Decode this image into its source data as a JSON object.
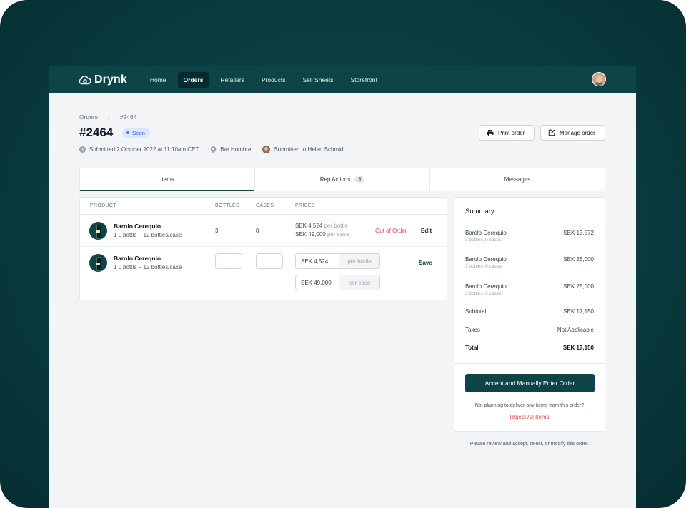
{
  "nav": {
    "logo": "Drynk",
    "items": [
      {
        "label": "Home",
        "active": false
      },
      {
        "label": "Orders",
        "active": true
      },
      {
        "label": "Retailers",
        "active": false
      },
      {
        "label": "Products",
        "active": false
      },
      {
        "label": "Sell Sheets",
        "active": false
      },
      {
        "label": "Storefront",
        "active": false
      }
    ]
  },
  "breadcrumb": {
    "parent": "Orders",
    "current": "#2464"
  },
  "order": {
    "title": "#2464",
    "status": "Seen",
    "submitted": "Submitted 2 October 2022 at 11:10am CET",
    "location": "Bar Hombre",
    "submitted_to": "Submitted to Helen Schmidt"
  },
  "actions": {
    "print": "Print order",
    "manage": "Manage order"
  },
  "tabs": [
    {
      "label": "Items",
      "active": true,
      "count": ""
    },
    {
      "label": "Rep Actions",
      "active": false,
      "count": "3"
    },
    {
      "label": "Messages",
      "active": false,
      "count": ""
    }
  ],
  "table": {
    "headers": {
      "product": "PRODUCT",
      "bottles": "BOTTLES",
      "cases": "CASES",
      "prices": "PRICES"
    },
    "rows": [
      {
        "name": "Barolo Cerequio",
        "detail": "1 L bottle – 12 bottles/case",
        "bottles": "3",
        "cases": "0",
        "price_bottle": "SEK 4,524",
        "price_bottle_unit": "per bottle",
        "price_case": "SEK 49,000",
        "price_case_unit": "per case",
        "status": "Out of Order",
        "action": "Edit"
      },
      {
        "name": "Barolo Cerequio",
        "detail": "1 L bottle – 12 bottles/case",
        "bottles": "",
        "cases": "",
        "price_bottle": "SEK 4,524",
        "price_bottle_unit": "per bottle",
        "price_case": "SEK 49,000",
        "price_case_unit": "per case",
        "action": "Save"
      }
    ]
  },
  "summary": {
    "title": "Summary",
    "lines": [
      {
        "label": "Barolo Cerequio",
        "sub": "3 bottles, 0 cases",
        "value": "SEK 13,572"
      },
      {
        "label": "Barolo Cerequio",
        "sub": "3 bottles, 0 cases",
        "value": "SEK 25,000"
      },
      {
        "label": "Barolo Cerequio",
        "sub": "3 bottles, 0 cases",
        "value": "SEK 25,000"
      }
    ],
    "subtotal_label": "Subtotal",
    "subtotal": "SEK 17,150",
    "taxes_label": "Taxes",
    "taxes": "Not Applicable",
    "total_label": "Total",
    "total": "SEK 17,150",
    "accept": "Accept and Manually Enter Order",
    "not_planning": "Not planning to deliver any items from this order?",
    "reject": "Reject All Items"
  },
  "review_note": "Please review and accept, reject, or modify this order.",
  "colors": {
    "brand": "#0d4448",
    "danger": "#ef4444",
    "badge_bg": "#dbe7ff"
  }
}
